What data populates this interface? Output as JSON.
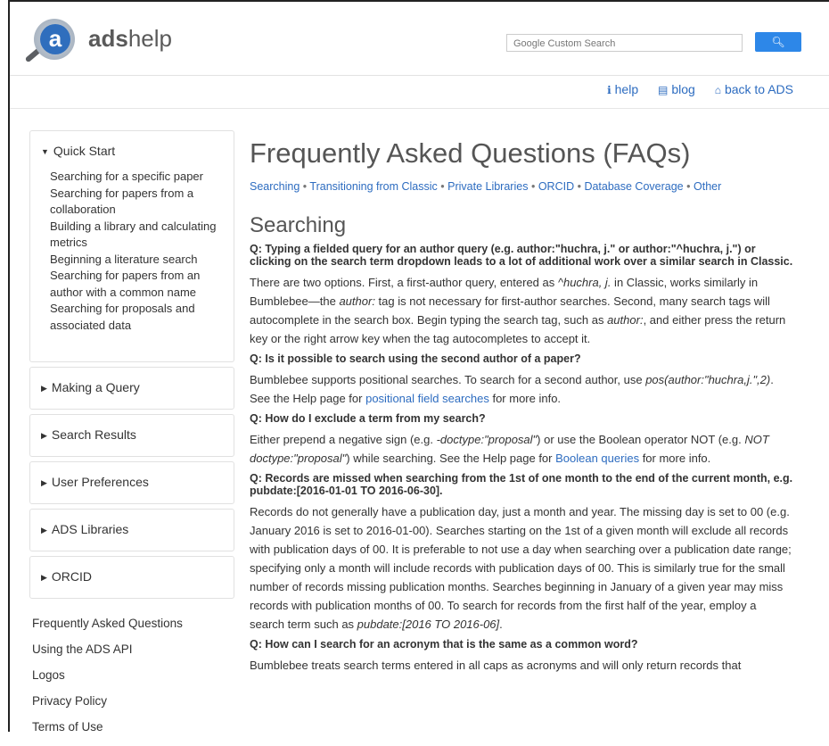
{
  "header": {
    "brand_bold": "ads",
    "brand_light": "help",
    "search_placeholder": "Google Custom Search",
    "search_button_icon": "search-icon"
  },
  "topnav": {
    "help": "help",
    "blog": "blog",
    "back": "back to ADS"
  },
  "sidebar": {
    "quick_start": {
      "title": "Quick Start",
      "items": [
        "Searching for a specific paper",
        "Searching for papers from a collaboration",
        "Building a library and calculating metrics",
        "Beginning a literature search",
        "Searching for papers from an author with a common name",
        "Searching for proposals and associated data"
      ]
    },
    "sections": [
      "Making a Query",
      "Search Results",
      "User Preferences",
      "ADS Libraries",
      "ORCID"
    ],
    "links": [
      "Frequently Asked Questions",
      "Using the ADS API",
      "Logos",
      "Privacy Policy",
      "Terms of Use"
    ]
  },
  "main": {
    "title": "Frequently Asked Questions (FAQs)",
    "categories": [
      "Searching",
      "Transitioning from Classic",
      "Private Libraries",
      "ORCID",
      "Database Coverage",
      "Other"
    ],
    "section_title": "Searching",
    "faqs": [
      {
        "q": "Q: Typing a fielded query for an author query (e.g. author:\"huchra, j.\" or author:\"^huchra, j.\") or clicking on the search term dropdown leads to a lot of additional work over a similar search in Classic.",
        "a1": "There are two options. First, a first-author query, entered as ",
        "a_em1": "^huchra, j.",
        "a2": " in Classic, works similarly in Bumblebee—the ",
        "a_em2": "author:",
        "a3": " tag is not necessary for first-author searches. Second, many search tags will autocomplete in the search box. Begin typing the search tag, such as ",
        "a_em3": "author:",
        "a4": ", and either press the return key or the right arrow key when the tag autocompletes to accept it."
      },
      {
        "q": "Q: Is it possible to search using the second author of a paper?",
        "a1": "Bumblebee supports positional searches. To search for a second author, use ",
        "a_em1": "pos(author:\"huchra,j.\",2)",
        "a2": ". See the Help page for ",
        "link": "positional field searches",
        "a3": " for more info."
      },
      {
        "q": "Q: How do I exclude a term from my search?",
        "a1": "Either prepend a negative sign (e.g. ",
        "a_em1": "-doctype:\"proposal\"",
        "a2": ") or use the Boolean operator NOT (e.g. ",
        "a_em2": "NOT doctype:\"proposal\"",
        "a3": ") while searching. See the Help page for ",
        "link": "Boolean queries",
        "a4": " for more info."
      },
      {
        "q": "Q: Records are missed when searching from the 1st of one month to the end of the current month, e.g. pubdate:[2016-01-01 TO 2016-06-30].",
        "a1": "Records do not generally have a publication day, just a month and year. The missing day is set to 00 (e.g. January 2016 is set to 2016-01-00). Searches starting on the 1st of a given month will exclude all records with publication days of 00. It is preferable to not use a day when searching over a publication date range; specifying only a month will include records with publication days of 00. This is similarly true for the small number of records missing publication months. Searches beginning in January of a given year may miss records with publication months of 00. To search for records from the first half of the year, employ a search term such as ",
        "a_em1": "pubdate:[2016 TO 2016-06]",
        "a2": "."
      },
      {
        "q": "Q: How can I search for an acronym that is the same as a common word?",
        "a1": "Bumblebee treats search terms entered in all caps as acronyms and will only return records that"
      }
    ]
  }
}
